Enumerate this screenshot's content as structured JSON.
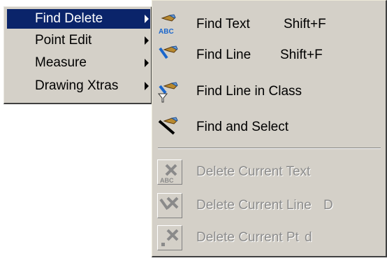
{
  "main_menu": {
    "items": [
      {
        "label": "Find Delete",
        "icon": "chevron-right-icon"
      },
      {
        "label": "Point Edit",
        "icon": "chevron-right-icon"
      },
      {
        "label": "Measure",
        "icon": "chevron-right-icon"
      },
      {
        "label": "Drawing Xtras",
        "icon": "chevron-right-icon"
      }
    ],
    "active_item": "Find Delete",
    "highlight_color": "#0a246a"
  },
  "submenu": {
    "items": [
      {
        "label": "Find Text",
        "shortcut": "Shift+F",
        "icon": "find-text-icon",
        "enabled": true
      },
      {
        "label": "Find Line",
        "shortcut": "Shift+F",
        "icon": "find-line-icon",
        "enabled": true
      },
      {
        "label": "Find Line in Class",
        "shortcut": "",
        "icon": "find-line-in-class-icon",
        "enabled": true
      },
      {
        "label": "Find and Select",
        "shortcut": "",
        "icon": "find-and-select-icon",
        "enabled": true
      },
      {
        "label": "Delete Current Text",
        "shortcut": "",
        "icon": "delete-text-icon",
        "enabled": false
      },
      {
        "label": "Delete Current Line",
        "shortcut": "D",
        "icon": "delete-line-icon",
        "enabled": false
      },
      {
        "label": "Delete Current Pt",
        "shortcut": "d",
        "icon": "delete-point-icon",
        "enabled": false
      }
    ],
    "icon_text": {
      "abc": "ABC"
    }
  },
  "colors": {
    "menu_bg": "#d4d0c8",
    "highlight": "#0a246a",
    "disabled_text": "#8c8c8c",
    "icon_blue": "#1a66cc",
    "icon_brown": "#8a5a22"
  }
}
